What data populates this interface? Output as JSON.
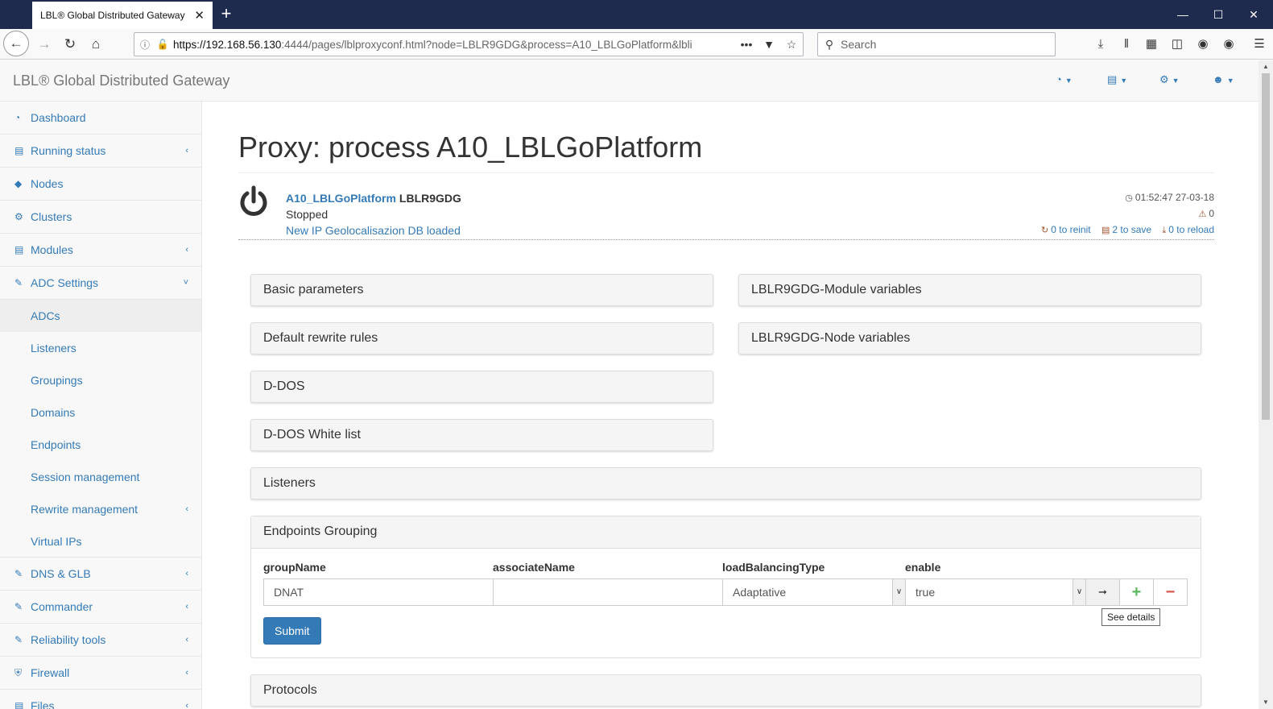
{
  "browser": {
    "tab_title": "LBL® Global Distributed Gateway",
    "tab_close": "✕",
    "new_tab": "+",
    "url_host": "https://192.168.56.130",
    "url_rest": ":4444/pages/lblproxyconf.html?node=LBLR9GDG&process=A10_LBLGoPlatform&lbli",
    "search_placeholder": "Search"
  },
  "app": {
    "brand": "LBL® Global Distributed Gateway"
  },
  "sidebar": {
    "items": [
      {
        "label": "Dashboard",
        "icon": "dashboard-icon"
      },
      {
        "label": "Running status",
        "icon": "bar-chart-icon",
        "arrow": "‹"
      },
      {
        "label": "Nodes",
        "icon": "cube-icon"
      },
      {
        "label": "Clusters",
        "icon": "cogs-icon"
      },
      {
        "label": "Modules",
        "icon": "list-icon",
        "arrow": "‹"
      },
      {
        "label": "ADC Settings",
        "icon": "edit-icon",
        "arrow": "˅"
      }
    ],
    "sub_items": [
      {
        "label": "ADCs",
        "active": true
      },
      {
        "label": "Listeners"
      },
      {
        "label": "Groupings"
      },
      {
        "label": "Domains"
      },
      {
        "label": "Endpoints"
      },
      {
        "label": "Session management"
      },
      {
        "label": "Rewrite management",
        "arrow": "‹"
      },
      {
        "label": "Virtual IPs"
      }
    ],
    "bottom_items": [
      {
        "label": "DNS & GLB",
        "icon": "edit-icon",
        "arrow": "‹"
      },
      {
        "label": "Commander",
        "icon": "edit-icon",
        "arrow": "‹"
      },
      {
        "label": "Reliability tools",
        "icon": "edit-icon",
        "arrow": "‹"
      },
      {
        "label": "Firewall",
        "icon": "shield-icon",
        "arrow": "‹"
      },
      {
        "label": "Files",
        "icon": "files-icon",
        "arrow": "‹"
      }
    ]
  },
  "page": {
    "title": "Proxy: process A10_LBLGoPlatform"
  },
  "process": {
    "name": "A10_LBLGoPlatform",
    "node": "LBLR9GDG",
    "state": "Stopped",
    "message": "New IP Geolocalisazion DB loaded",
    "time": "01:52:47 27-03-18",
    "warnings": "0",
    "to_reinit": "0 to reinit",
    "to_save": "2 to save",
    "to_reload": "0 to reload"
  },
  "panels": {
    "basic": "Basic parameters",
    "module_vars": "LBLR9GDG-Module variables",
    "rewrite": "Default rewrite rules",
    "node_vars": "LBLR9GDG-Node variables",
    "ddos": "D-DOS",
    "ddos_white": "D-DOS White list",
    "listeners": "Listeners",
    "protocols": "Protocols"
  },
  "endpoints_grouping": {
    "title": "Endpoints Grouping",
    "labels": {
      "group_name": "groupName",
      "associate_name": "associateName",
      "lb_type": "loadBalancingType",
      "enable": "enable"
    },
    "values": {
      "group_name": "DNAT",
      "associate_name": "",
      "lb_type": "Adaptative",
      "enable": "true"
    },
    "tooltip": "See details",
    "submit": "Submit"
  }
}
